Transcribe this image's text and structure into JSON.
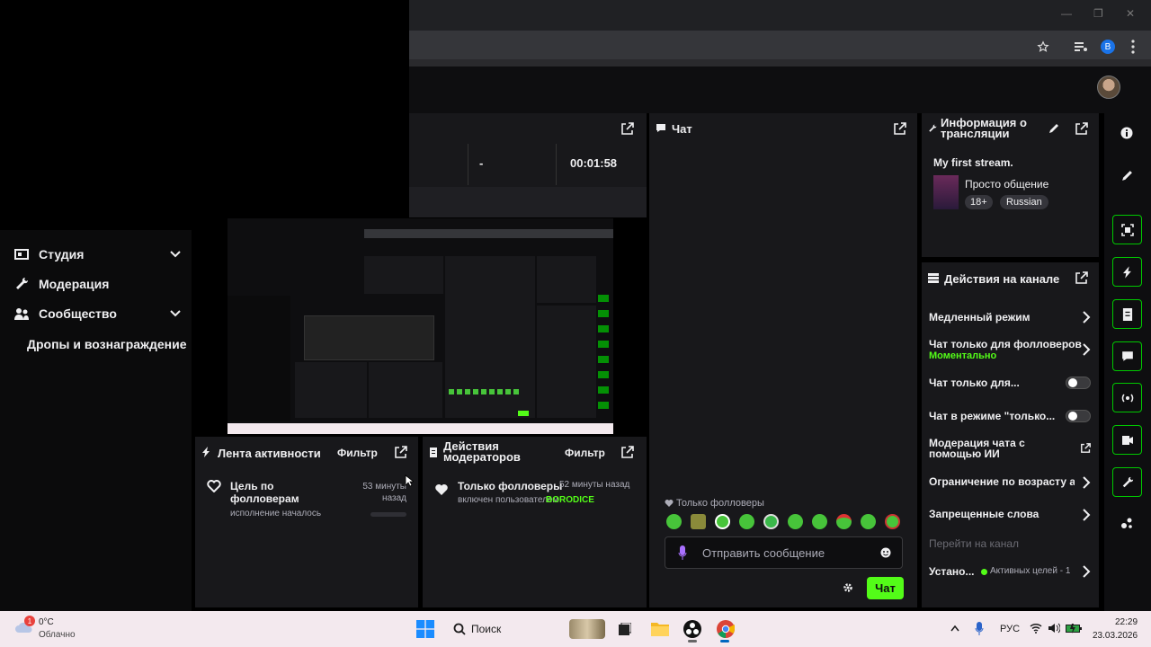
{
  "window": {
    "minimize": "—",
    "maximize": "❐",
    "close": "✕"
  },
  "browser": {
    "profile_initial": "B"
  },
  "sidebar": {
    "items": [
      {
        "label": "Студия"
      },
      {
        "label": "Модерация"
      },
      {
        "label": "Сообщество"
      },
      {
        "label": "Дропы и вознаграждение"
      }
    ]
  },
  "stats": {
    "dash": "-",
    "timer": "00:01:58"
  },
  "chat": {
    "title": "Чат",
    "mode_label": "Только фолловеры",
    "input_placeholder": "Отправить сообщение",
    "send_label": "Чат"
  },
  "stream_info": {
    "title": "Информация о трансляции",
    "stream_title": "My first stream.",
    "category": "Просто общение",
    "tags": [
      "18+",
      "Russian"
    ]
  },
  "channel_actions": {
    "title": "Действия на канале",
    "items": [
      {
        "label": "Медленный режим"
      },
      {
        "label": "Чат только для фолловеров",
        "sublabel": "Моментально"
      },
      {
        "label": "Чат только для..."
      },
      {
        "label": "Чат в режиме \"только..."
      },
      {
        "label": "Модерация чата с помощью ИИ"
      },
      {
        "label": "Ограничение по возрасту а"
      },
      {
        "label": "Запрещенные слова"
      },
      {
        "label": "Перейти на канал"
      },
      {
        "label": "Устано...",
        "sublabel": "Активных целей - 1"
      }
    ]
  },
  "activity": {
    "title": "Лента активности",
    "filter": "Фильтр",
    "event_title": "Цель по фолловерам",
    "event_sub": "исполнение началось",
    "event_time": "53 минуты назад"
  },
  "mod_actions": {
    "title": "Действия модераторов",
    "filter": "Фильтр",
    "event_title": "Только фолловеры",
    "event_time": "52 минуты назад",
    "event_sub": "включен пользователем",
    "event_user": "BORODICE"
  },
  "taskbar": {
    "weather_temp": "0°C",
    "weather_desc": "Облачно",
    "weather_badge": "1",
    "search": "Поиск",
    "lang": "РУС",
    "time": "22:29",
    "date": "23.03.2026"
  },
  "colors": {
    "accent": "#53fc18",
    "panel": "#18181b",
    "bg": "#0e0e10"
  }
}
